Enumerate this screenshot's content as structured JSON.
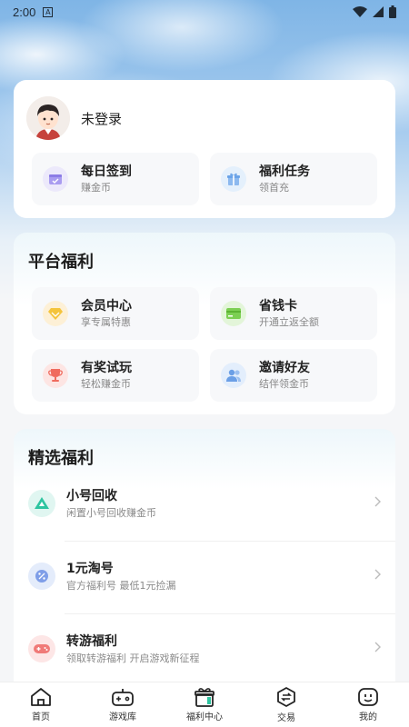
{
  "status": {
    "time": "2:00"
  },
  "user": {
    "name": "未登录"
  },
  "quick": [
    {
      "title": "每日签到",
      "sub": "赚金币"
    },
    {
      "title": "福利任务",
      "sub": "领首充"
    }
  ],
  "platform": {
    "title": "平台福利",
    "items": [
      {
        "title": "会员中心",
        "sub": "享专属特惠"
      },
      {
        "title": "省钱卡",
        "sub": "开通立返全额"
      },
      {
        "title": "有奖试玩",
        "sub": "轻松赚金币"
      },
      {
        "title": "邀请好友",
        "sub": "结伴领金币"
      }
    ]
  },
  "select": {
    "title": "精选福利",
    "items": [
      {
        "title": "小号回收",
        "sub": "闲置小号回收赚金币"
      },
      {
        "title": "1元淘号",
        "sub": "官方福利号 最低1元捡漏"
      },
      {
        "title": "转游福利",
        "sub": "领取转游福利 开启游戏新征程"
      }
    ]
  },
  "tabs": [
    {
      "label": "首页"
    },
    {
      "label": "游戏库"
    },
    {
      "label": "福利中心"
    },
    {
      "label": "交易"
    },
    {
      "label": "我的"
    }
  ],
  "colors": {
    "accent": "#2ec4a0",
    "background": "#f5f6f8"
  }
}
